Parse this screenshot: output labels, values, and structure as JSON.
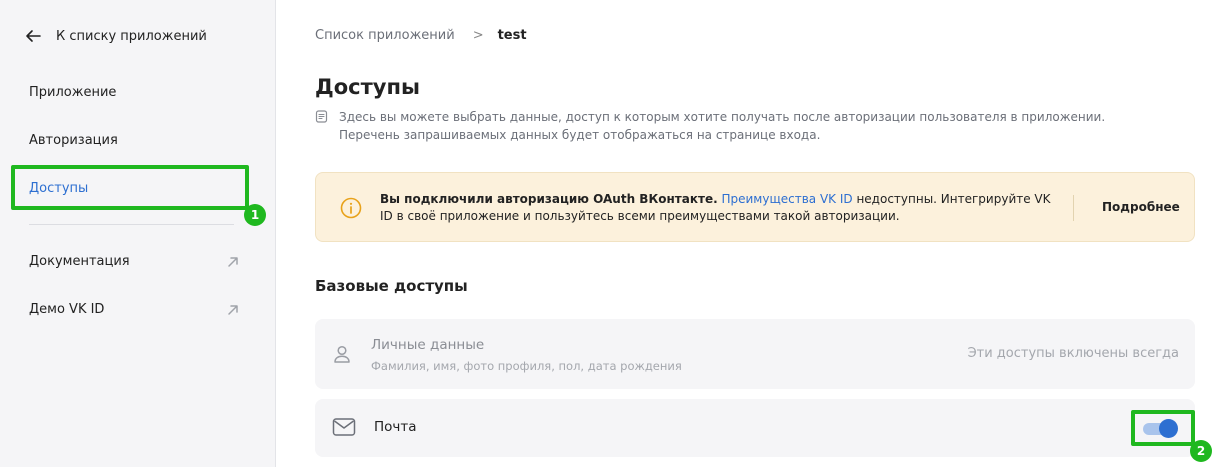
{
  "sidebar": {
    "back_label": "К списку приложений",
    "items": [
      {
        "label": "Приложение"
      },
      {
        "label": "Авторизация"
      },
      {
        "label": "Доступы"
      },
      {
        "label": "Документация"
      },
      {
        "label": "Демо VK ID"
      }
    ]
  },
  "breadcrumb": {
    "parent": "Список приложений",
    "separator": ">",
    "current": "test"
  },
  "page": {
    "title": "Доступы",
    "description": "Здесь вы можете выбрать данные, доступ к которым хотите получать после авторизации пользователя в приложении. Перечень запрашиваемых данных будет отображаться на странице входа."
  },
  "banner": {
    "bold_text": "Вы подключили авторизацию OAuth ВКонтакте.",
    "link_text": "Преимущества VK ID",
    "rest_text": " недоступны. Интегрируйте VK ID в своё приложение и пользуйтесь всеми преимуществами такой авторизации.",
    "more_button": "Подробнее"
  },
  "section": {
    "title": "Базовые доступы"
  },
  "access_rows": [
    {
      "title": "Личные данные",
      "subtitle": "Фамилия, имя, фото профиля, пол, дата рождения",
      "right_text": "Эти доступы включены всегда",
      "icon": "person-icon"
    },
    {
      "title": "Почта",
      "icon": "mail-icon",
      "toggle_on": true
    }
  ],
  "annotations": [
    {
      "number": "1"
    },
    {
      "number": "2"
    }
  ],
  "colors": {
    "accent": "#2d6fd1",
    "annotation": "#1fb81f",
    "banner_bg": "#fcf1dc",
    "sidebar_bg": "#f5f5f7"
  }
}
